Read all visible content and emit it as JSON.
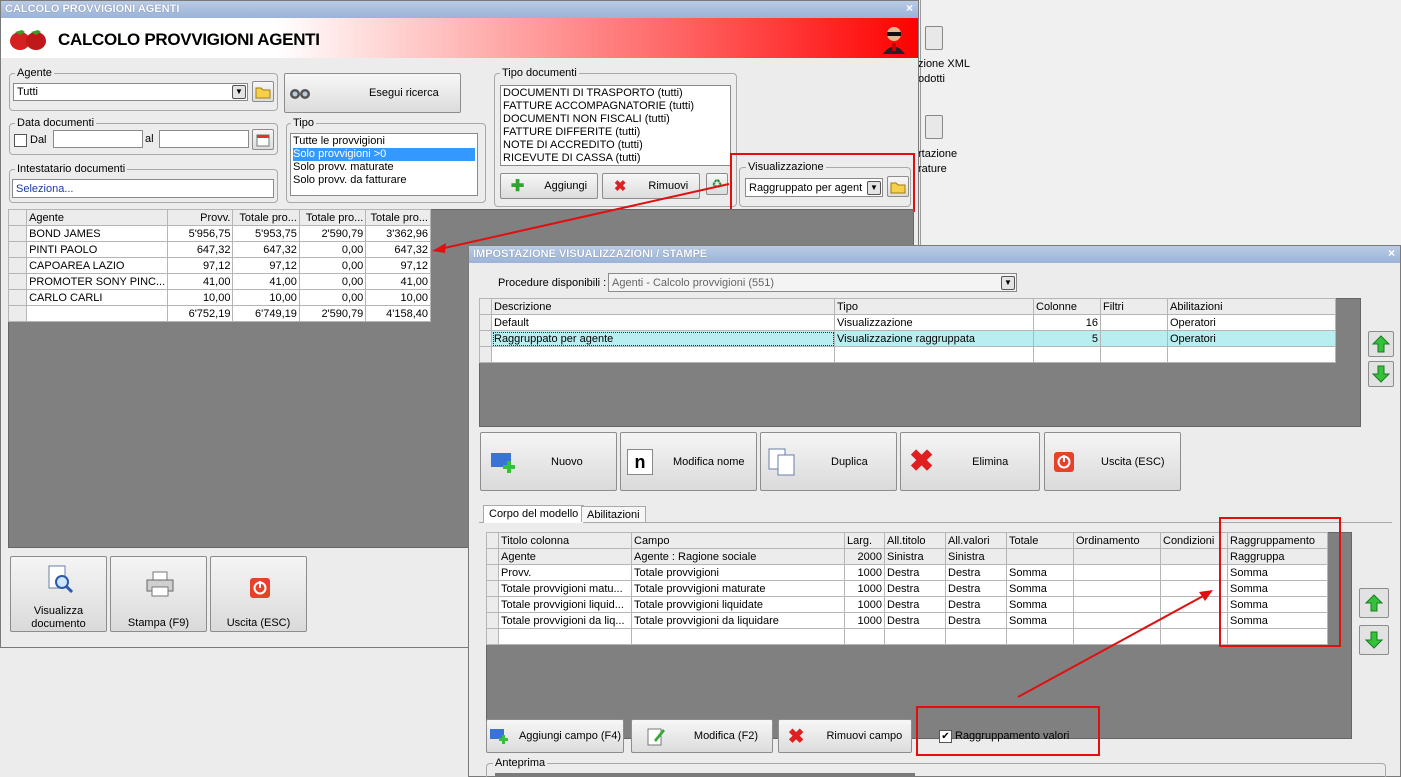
{
  "desktop": {
    "icon1": {
      "line1": "zione XML",
      "line2": "odotti"
    },
    "icon2": {
      "line1": "rtazione",
      "line2": "rature"
    }
  },
  "main_window": {
    "title_bar": "CALCOLO PROVVIGIONI AGENTI",
    "close": "×",
    "header_title": "CALCOLO PROVVIGIONI AGENTI",
    "agente": {
      "label": "Agente",
      "value": "Tutti"
    },
    "esegui_ricerca": "Esegui ricerca",
    "data_documenti": {
      "label": "Data documenti",
      "dal": "Dal",
      "al": "al"
    },
    "tipo": {
      "label": "Tipo",
      "items": [
        "Tutte le provvigioni",
        "Solo provvigioni >0",
        "Solo provv. maturate",
        "Solo provv. da fatturare"
      ],
      "selected_index": 1
    },
    "intestatario": {
      "label": "Intestatario documenti",
      "value": "Seleziona..."
    },
    "tipo_documenti": {
      "label": "Tipo documenti",
      "items": [
        "DOCUMENTI DI TRASPORTO (tutti)",
        "FATTURE ACCOMPAGNATORIE (tutti)",
        "DOCUMENTI NON FISCALI (tutti)",
        "FATTURE DIFFERITE (tutti)",
        "NOTE DI ACCREDITO (tutti)",
        "RICEVUTE DI CASSA (tutti)"
      ]
    },
    "aggiungi": "Aggiungi",
    "rimuovi": "Rimuovi",
    "visualizzazione": {
      "label": "Visualizzazione",
      "value": "Raggruppato per agent"
    },
    "table": {
      "headers": [
        "Agente",
        "Provv.",
        "Totale pro...",
        "Totale pro...",
        "Totale pro..."
      ],
      "rows": [
        [
          "BOND JAMES",
          "5'956,75",
          "5'953,75",
          "2'590,79",
          "3'362,96"
        ],
        [
          "PINTI PAOLO",
          "647,32",
          "647,32",
          "0,00",
          "647,32"
        ],
        [
          "CAPOAREA LAZIO",
          "97,12",
          "97,12",
          "0,00",
          "97,12"
        ],
        [
          "PROMOTER SONY PINC...",
          "41,00",
          "41,00",
          "0,00",
          "41,00"
        ],
        [
          "CARLO CARLI",
          "10,00",
          "10,00",
          "0,00",
          "10,00"
        ]
      ],
      "totals": [
        "",
        "6'752,19",
        "6'749,19",
        "2'590,79",
        "4'158,40"
      ]
    },
    "footer": {
      "visualizza_l1": "Visualizza",
      "visualizza_l2": "documento",
      "stampa": "Stampa (F9)",
      "uscita": "Uscita (ESC)"
    }
  },
  "dialog": {
    "title_bar": "IMPOSTAZIONE VISUALIZZAZIONI / STAMPE",
    "close": "×",
    "procedure": {
      "label": "Procedure disponibili :",
      "value": "Agenti - Calcolo provvigioni (551)"
    },
    "views_table": {
      "headers": [
        "Descrizione",
        "Tipo",
        "Colonne",
        "Filtri",
        "Abilitazioni"
      ],
      "rows": [
        [
          "Default",
          "Visualizzazione",
          "16",
          "",
          "Operatori"
        ],
        [
          "Raggruppato per agente",
          "Visualizzazione raggruppata",
          "5",
          "",
          "Operatori"
        ]
      ]
    },
    "buttons": {
      "nuovo": "Nuovo",
      "modifica_nome": "Modifica nome",
      "duplica": "Duplica",
      "elimina": "Elimina",
      "uscita": "Uscita (ESC)"
    },
    "tabs": [
      "Corpo del modello",
      "Abilitazioni"
    ],
    "fields_table": {
      "headers": [
        "Titolo colonna",
        "Campo",
        "Larg.",
        "All.titolo",
        "All.valori",
        "Totale",
        "Ordinamento",
        "Condizioni",
        "Raggruppamento"
      ],
      "rows": [
        [
          "Agente",
          "Agente : Ragione sociale",
          "2000",
          "Sinistra",
          "Sinistra",
          "",
          "",
          "",
          "Raggruppa"
        ],
        [
          "Provv.",
          "Totale provvigioni",
          "1000",
          "Destra",
          "Destra",
          "Somma",
          "",
          "",
          "Somma"
        ],
        [
          "Totale provvigioni matu...",
          "Totale provvigioni maturate",
          "1000",
          "Destra",
          "Destra",
          "Somma",
          "",
          "",
          "Somma"
        ],
        [
          "Totale provvigioni liquid...",
          "Totale provvigioni liquidate",
          "1000",
          "Destra",
          "Destra",
          "Somma",
          "",
          "",
          "Somma"
        ],
        [
          "Totale provvigioni da liq...",
          "Totale provvigioni da liquidare",
          "1000",
          "Destra",
          "Destra",
          "Somma",
          "",
          "",
          "Somma"
        ]
      ]
    },
    "aggiungi_campo": "Aggiungi campo (F4)",
    "modifica": "Modifica (F2)",
    "rimuovi_campo": "Rimuovi campo",
    "raggruppamento_valori": {
      "label": "Raggruppamento valori",
      "checked": true
    },
    "anteprima": "Anteprima"
  },
  "colors": {
    "highlight_red": "#e01010",
    "selected_row": "#b8eef0",
    "title_bar": "#9bb3d8"
  }
}
